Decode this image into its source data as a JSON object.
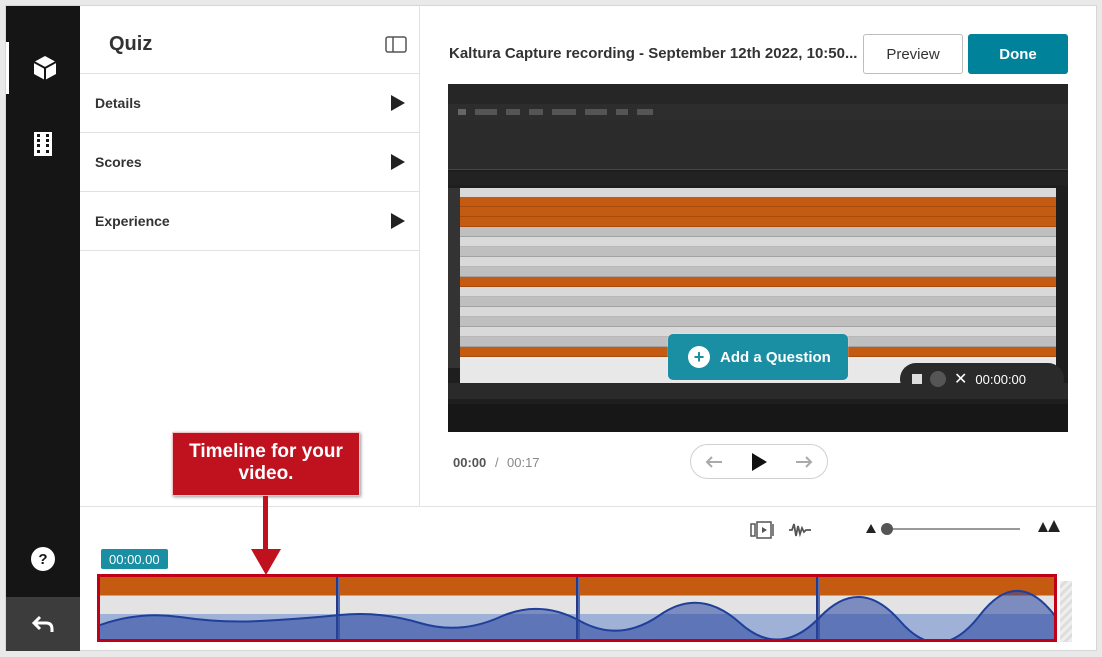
{
  "panel": {
    "title": "Quiz",
    "sections": [
      {
        "label": "Details"
      },
      {
        "label": "Scores"
      },
      {
        "label": "Experience"
      }
    ]
  },
  "header": {
    "video_title": "Kaltura Capture recording - September 12th 2022, 10:50...",
    "preview_label": "Preview",
    "done_label": "Done"
  },
  "video": {
    "add_question_label": "Add a Question",
    "recorder_time": "00:00:00"
  },
  "playback": {
    "current_time": "00:00",
    "separator": "/",
    "total_time": "00:17"
  },
  "timeline": {
    "timecode": "00:00.00"
  },
  "callout": {
    "text": "Timeline for your video."
  },
  "icons": {
    "rail": [
      "cube-icon",
      "film-icon",
      "help-icon",
      "undo-icon"
    ],
    "controls": [
      "step-back-icon",
      "play-icon",
      "step-forward-icon"
    ],
    "timeline_tools": [
      "slides-icon",
      "waveform-icon"
    ]
  },
  "colors": {
    "accent": "#00829b",
    "rail_bg": "#151515",
    "callout": "#c0111f"
  }
}
